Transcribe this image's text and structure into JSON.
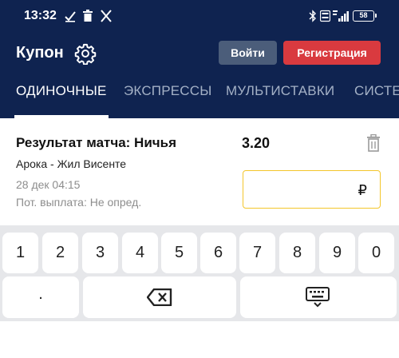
{
  "status_bar": {
    "time": "13:32",
    "battery": "58",
    "left_icons": [
      "download-done-icon",
      "trash-status-icon",
      "x-app-icon"
    ],
    "right_icons": [
      "bluetooth-icon",
      "volte-icon",
      "signal-4g-icon",
      "battery-icon"
    ]
  },
  "header": {
    "title": "Купон",
    "login_label": "Войти",
    "register_label": "Регистрация",
    "colors": {
      "background": "#0f2350",
      "login": "#4b5d7a",
      "register": "#d93a3f"
    }
  },
  "tabs": [
    {
      "label": "ОДИНОЧНЫЕ",
      "active": true
    },
    {
      "label": "ЭКСПРЕССЫ",
      "active": false
    },
    {
      "label": "МУЛЬТИСТАВКИ",
      "active": false
    },
    {
      "label": "СИСТЕ",
      "active": false
    }
  ],
  "bet": {
    "market": "Результат матча: Ничья",
    "odds": "3.20",
    "teams": "Арока - Жил Висенте",
    "datetime": "28 дек 04:15",
    "payout": "Пот. выплата: Не опред.",
    "stake_value": "",
    "currency": "₽",
    "colors": {
      "stake_border": "#f3c62b"
    }
  },
  "keyboard": {
    "digits": [
      "1",
      "2",
      "3",
      "4",
      "5",
      "6",
      "7",
      "8",
      "9",
      "0"
    ],
    "dot": ".",
    "icons": [
      "backspace-icon",
      "keyboard-hide-icon"
    ]
  }
}
